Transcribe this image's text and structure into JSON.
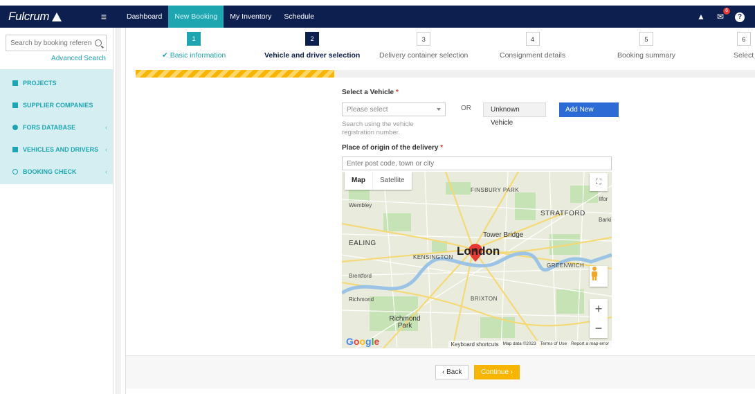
{
  "brand": {
    "name": "Fulcrum"
  },
  "nav": {
    "links": [
      {
        "label": "Dashboard"
      },
      {
        "label": "New Booking"
      },
      {
        "label": "My Inventory"
      },
      {
        "label": "Schedule"
      }
    ],
    "mail_badge": "6"
  },
  "sidebar": {
    "search_placeholder": "Search by booking reference",
    "advanced_search": "Advanced Search",
    "items": [
      {
        "label": "PROJECTS"
      },
      {
        "label": "SUPPLIER COMPANIES"
      },
      {
        "label": "FORS DATABASE"
      },
      {
        "label": "VEHICLES AND DRIVERS"
      },
      {
        "label": "BOOKING CHECK"
      }
    ]
  },
  "steps": [
    {
      "num": "1",
      "label": "✔ Basic information",
      "state": "done"
    },
    {
      "num": "2",
      "label": "Vehicle and driver selection",
      "state": "active"
    },
    {
      "num": "3",
      "label": "Delivery container selection",
      "state": "todo"
    },
    {
      "num": "4",
      "label": "Consignment details",
      "state": "todo"
    },
    {
      "num": "5",
      "label": "Booking summary",
      "state": "todo"
    },
    {
      "num": "6",
      "label": "Select",
      "state": "todo"
    }
  ],
  "progress": {
    "fraction": 0.32
  },
  "form": {
    "vehicle_label": "Select a Vehicle",
    "required_mark": "*",
    "vehicle_placeholder": "Please select",
    "or": "OR",
    "unknown_vehicle": "Unknown Vehicle",
    "add_new_vehicle": "Add New Vehicle",
    "vehicle_help": "Search using the vehicle registration number.",
    "origin_label": "Place of origin of the delivery",
    "origin_placeholder": "Enter post code, town or city"
  },
  "map": {
    "type_map": "Map",
    "type_satellite": "Satellite",
    "labels": {
      "london": "London",
      "kensington": "KENSINGTON",
      "tower_bridge": "Tower Bridge",
      "stratford": "STRATFORD",
      "greenwich": "GREENWICH",
      "ealing": "EALING",
      "wembley": "Wembley",
      "brentford": "Brentford",
      "richmond": "Richmond",
      "richmond_park": "Richmond Park",
      "brixton": "BRIXTON",
      "finsbury_park": "FINSBURY PARK",
      "ilford": "Ilfor",
      "barking": "Barki"
    },
    "attribution": {
      "shortcuts": "Keyboard shortcuts",
      "data": "Map data ©2023",
      "terms": "Terms of Use",
      "report": "Report a map error"
    },
    "google": "Google"
  },
  "footer": {
    "back": "‹ Back",
    "continue": "Continue ›"
  }
}
